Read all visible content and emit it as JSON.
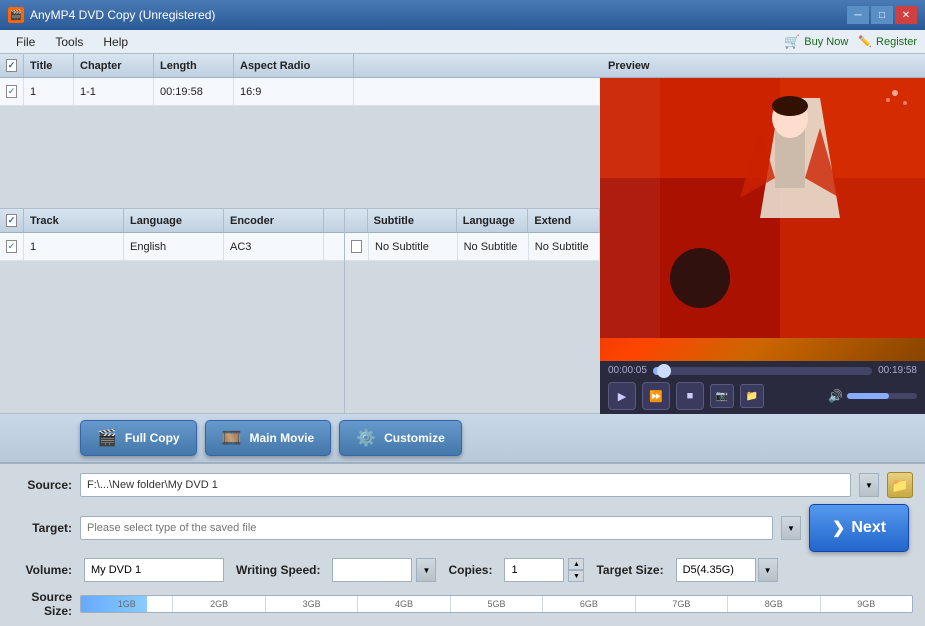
{
  "titlebar": {
    "title": "AnyMP4 DVD Copy (Unregistered)",
    "logo": "A"
  },
  "menu": {
    "items": [
      "File",
      "Tools",
      "Help"
    ],
    "buy_label": "Buy Now",
    "register_label": "Register"
  },
  "title_table": {
    "headers": {
      "check": "",
      "title": "Title",
      "chapter": "Chapter",
      "length": "Length",
      "aspect": "Aspect Radio"
    },
    "rows": [
      {
        "check": true,
        "title": "1",
        "chapter": "1-1",
        "length": "00:19:58",
        "aspect": "16:9"
      }
    ]
  },
  "audio_table": {
    "headers": {
      "check": "",
      "track": "Track",
      "language": "Language",
      "encoder": "Encoder"
    },
    "rows": [
      {
        "check": true,
        "track": "1",
        "language": "English",
        "encoder": "AC3"
      }
    ]
  },
  "subtitle_table": {
    "headers": {
      "check": "",
      "subtitle": "Subtitle",
      "language": "Language",
      "extend": "Extend"
    },
    "rows": [
      {
        "check": false,
        "subtitle": "No Subtitle",
        "language": "No Subtitle",
        "extend": "No Subtitle"
      }
    ]
  },
  "preview": {
    "label": "Preview",
    "time_start": "00:00:05",
    "time_end": "00:19:58"
  },
  "mode_buttons": {
    "full_copy": "Full Copy",
    "main_movie": "Main Movie",
    "customize": "Customize"
  },
  "form": {
    "source_label": "Source:",
    "source_value": "F:\\...\\New folder\\My DVD 1",
    "target_label": "Target:",
    "target_placeholder": "Please select type of the saved file",
    "volume_label": "Volume:",
    "volume_value": "My DVD 1",
    "writing_speed_label": "Writing Speed:",
    "writing_speed_value": "",
    "copies_label": "Copies:",
    "copies_value": "1",
    "target_size_label": "Target Size:",
    "target_size_value": "D5(4.35G)",
    "source_size_label": "Source Size:",
    "size_ticks": [
      "1GB",
      "2GB",
      "3GB",
      "4GB",
      "5GB",
      "6GB",
      "7GB",
      "8GB",
      "9GB"
    ]
  },
  "next_button": {
    "label": "Next",
    "arrow": "❯"
  }
}
